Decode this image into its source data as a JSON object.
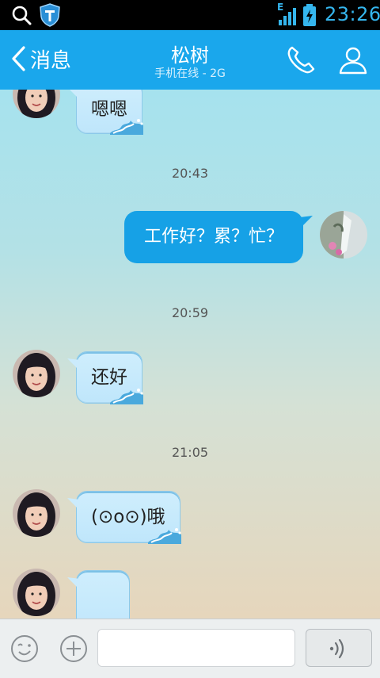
{
  "status_bar": {
    "network_type": "E",
    "time": "23:26",
    "icons": [
      "search-icon",
      "shield-icon",
      "signal-icon",
      "battery-icon"
    ]
  },
  "header": {
    "back_label": "消息",
    "title": "松树",
    "subtitle": "手机在线 - 2G",
    "icons": [
      "call-icon",
      "contact-icon"
    ]
  },
  "messages": [
    {
      "side": "left",
      "text": "嗯嗯"
    },
    {
      "type": "time",
      "text": "20:43"
    },
    {
      "side": "right",
      "text": "工作好？累？忙？"
    },
    {
      "type": "time",
      "text": "20:59"
    },
    {
      "side": "left",
      "text": "还好"
    },
    {
      "type": "time",
      "text": "21:05"
    },
    {
      "side": "left",
      "text": "(⊙o⊙)哦"
    },
    {
      "side": "left",
      "text": ""
    }
  ],
  "input": {
    "value": "",
    "icons": [
      "emoji-icon",
      "plus-icon",
      "voice-icon"
    ]
  },
  "colors": {
    "title_bar": "#1aa7ec",
    "outgoing_bubble": "#16a1e6",
    "incoming_bubble": "#c8eafc",
    "status_time": "#35b6ee"
  }
}
